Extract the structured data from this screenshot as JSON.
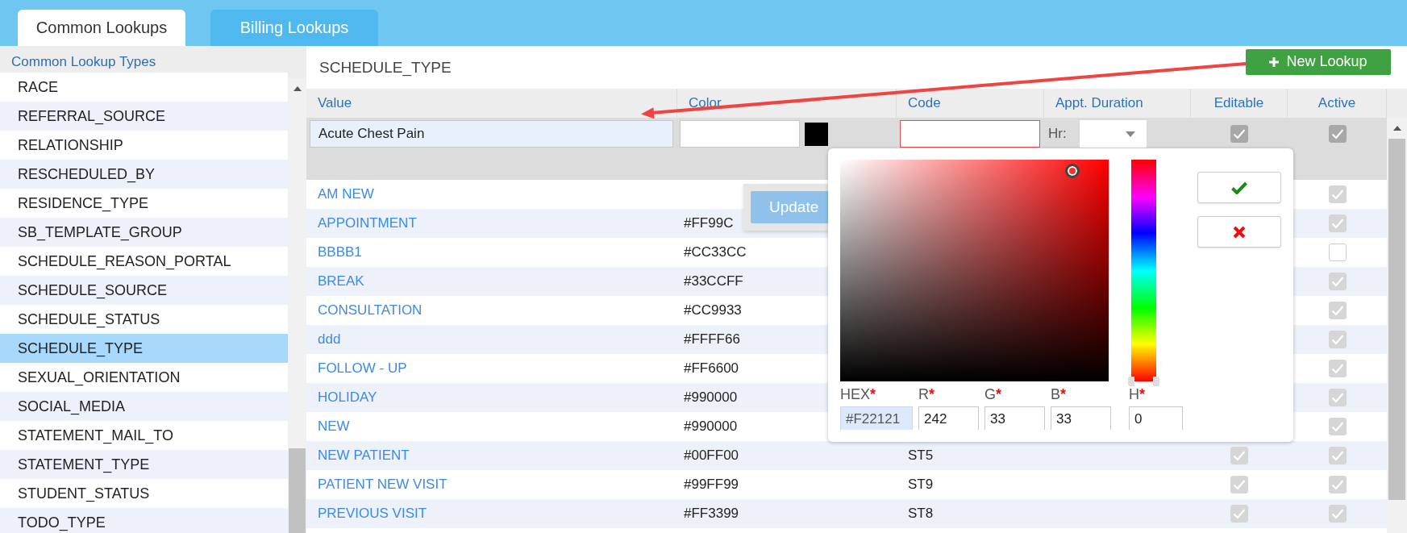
{
  "tabs": [
    {
      "label": "Common Lookups",
      "selected": true
    },
    {
      "label": "Billing Lookups",
      "selected": false
    }
  ],
  "sidebar": {
    "title": "Common Lookup Types",
    "items": [
      {
        "label": "RACE",
        "selected": false
      },
      {
        "label": "REFERRAL_SOURCE",
        "selected": false
      },
      {
        "label": "RELATIONSHIP",
        "selected": false
      },
      {
        "label": "RESCHEDULED_BY",
        "selected": false
      },
      {
        "label": "RESIDENCE_TYPE",
        "selected": false
      },
      {
        "label": "SB_TEMPLATE_GROUP",
        "selected": false
      },
      {
        "label": "SCHEDULE_REASON_PORTAL",
        "selected": false
      },
      {
        "label": "SCHEDULE_SOURCE",
        "selected": false
      },
      {
        "label": "SCHEDULE_STATUS",
        "selected": false
      },
      {
        "label": "SCHEDULE_TYPE",
        "selected": true
      },
      {
        "label": "SEXUAL_ORIENTATION",
        "selected": false
      },
      {
        "label": "SOCIAL_MEDIA",
        "selected": false
      },
      {
        "label": "STATEMENT_MAIL_TO",
        "selected": false
      },
      {
        "label": "STATEMENT_TYPE",
        "selected": false
      },
      {
        "label": "STUDENT_STATUS",
        "selected": false
      },
      {
        "label": "TODO_TYPE",
        "selected": false
      }
    ]
  },
  "main": {
    "title": "SCHEDULE_TYPE",
    "new_button": "New Lookup"
  },
  "table": {
    "columns": [
      "Value",
      "Color",
      "Code",
      "Appt. Duration",
      "Editable",
      "Active"
    ],
    "edit_row": {
      "value": "Acute Chest Pain",
      "hours_label": "Hr:",
      "editable": true,
      "active": true
    },
    "rows": [
      {
        "value": "AM NEW",
        "active": true
      },
      {
        "value": "APPOINTMENT",
        "color_code": "#FF99C",
        "active": true
      },
      {
        "value": "BBBB1",
        "color_code": "#CC33CC",
        "active": false
      },
      {
        "value": "BREAK",
        "color_code": "#33CCFF",
        "active": true
      },
      {
        "value": "CONSULTATION",
        "color_code": "#CC9933",
        "active": true
      },
      {
        "value": "ddd",
        "color_code": "#FFFF66",
        "active": true
      },
      {
        "value": "FOLLOW - UP",
        "color_code": "#FF6600",
        "active": true
      },
      {
        "value": "HOLIDAY",
        "color_code": "#990000",
        "active": true
      },
      {
        "value": "NEW",
        "color_code": "#990000",
        "active": true
      },
      {
        "value": "NEW PATIENT",
        "color_code": "#00FF00",
        "code": "ST5",
        "editable": true,
        "active": true
      },
      {
        "value": "PATIENT NEW VISIT",
        "color_code": "#99FF99",
        "code": "ST9",
        "editable": true,
        "active": true
      },
      {
        "value": "PREVIOUS VISIT",
        "color_code": "#FF3399",
        "code": "ST8",
        "editable": true,
        "active": true
      }
    ]
  },
  "update_button": "Update",
  "color_picker": {
    "hue_slider": {
      "level": 0
    },
    "fields": [
      {
        "label": "HEX",
        "mark": "*",
        "value": "#F22121"
      },
      {
        "label": "R",
        "mark": "*",
        "value": "242"
      },
      {
        "label": "G",
        "mark": "*",
        "value": "33"
      },
      {
        "label": "B",
        "mark": "*",
        "value": "33"
      },
      {
        "label": "H",
        "mark": "*",
        "value": "0"
      }
    ]
  }
}
